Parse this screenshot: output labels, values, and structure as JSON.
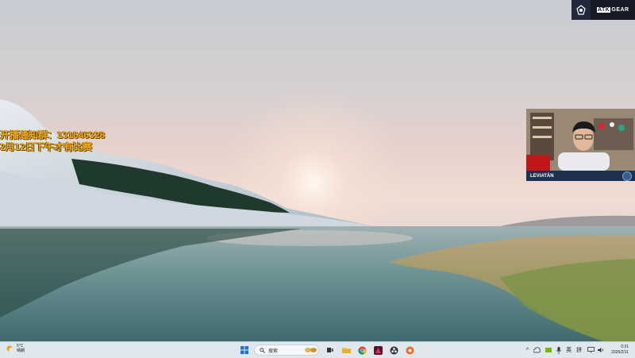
{
  "overlay": {
    "line1": "开播通知群：131646328",
    "line2": "2月12日下午才有比赛"
  },
  "brand": {
    "box": "ATK",
    "name": "GEAR"
  },
  "webcam": {
    "name": "LEVIATÁN"
  },
  "taskbar": {
    "weather_temp": "5°C",
    "weather_desc": "晴朗",
    "search_placeholder": "搜索",
    "apps": [
      "start-icon",
      "search-icon",
      "file-explorer-icon",
      "chrome-icon",
      "app-red-icon",
      "obs-icon",
      "app-orange-icon"
    ],
    "tray": {
      "chevron": "^",
      "ime_lang": "英",
      "ime_mode": "拼"
    },
    "time": "0:31",
    "date": "2026/2/11"
  }
}
